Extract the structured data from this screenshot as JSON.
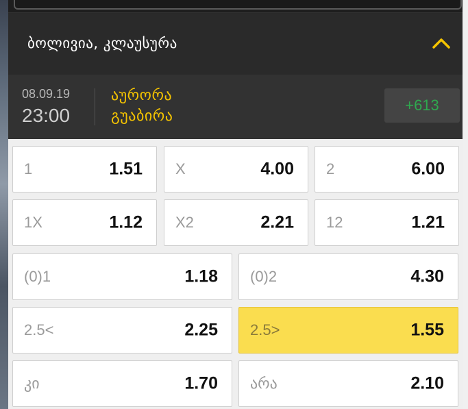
{
  "league": {
    "title": "ბოლივია, კლაუსურა",
    "collapse_icon": "chevron-up-icon",
    "accent": "#f5c400"
  },
  "match": {
    "date": "08.09.19",
    "time": "23:00",
    "home": "აურორა",
    "away": "გუაბირა",
    "more_markets": "+613"
  },
  "odds": {
    "row1": [
      {
        "label": "1",
        "value": "1.51"
      },
      {
        "label": "X",
        "value": "4.00"
      },
      {
        "label": "2",
        "value": "6.00"
      }
    ],
    "row2": [
      {
        "label": "1X",
        "value": "1.12"
      },
      {
        "label": "X2",
        "value": "2.21"
      },
      {
        "label": "12",
        "value": "1.21"
      }
    ],
    "row3": [
      {
        "label": "(0)1",
        "value": "1.18"
      },
      {
        "label": "(0)2",
        "value": "4.30"
      }
    ],
    "row4": [
      {
        "label": "2.5<",
        "value": "2.25"
      },
      {
        "label": "2.5>",
        "value": "1.55",
        "selected": true
      }
    ],
    "row5": [
      {
        "label": "კი",
        "value": "1.70"
      },
      {
        "label": "არა",
        "value": "2.10"
      }
    ]
  },
  "colors": {
    "selected_bg": "#fadd4f",
    "more_markets_text": "#2fa84f"
  }
}
